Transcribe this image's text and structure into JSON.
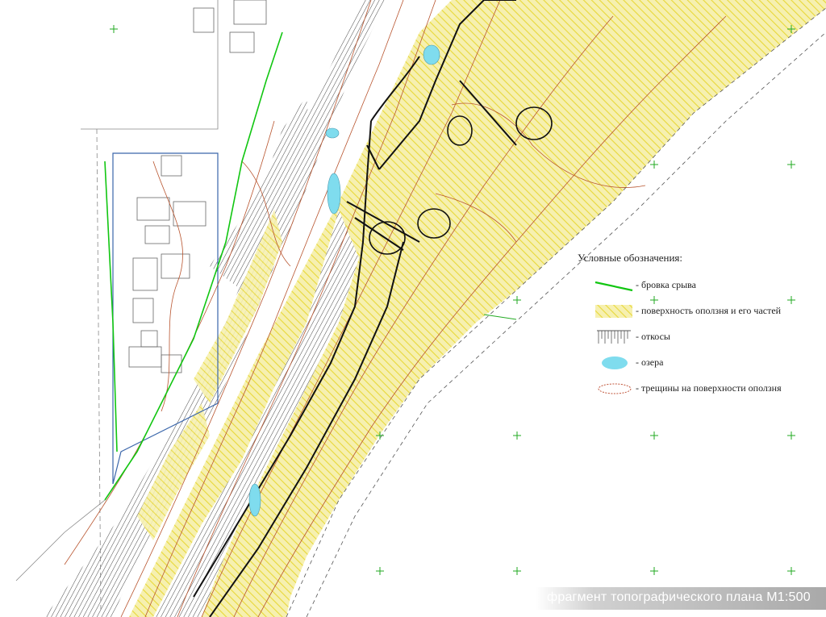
{
  "legend": {
    "title": "Условные обозначения:",
    "items": [
      {
        "id": "scarp",
        "label": "- бровка срыва",
        "color": "#11c611"
      },
      {
        "id": "surface",
        "label": "- поверхность оползня и его частей",
        "color": "#e8d83a"
      },
      {
        "id": "slopes",
        "label": "- откосы",
        "color": "#555555"
      },
      {
        "id": "lakes",
        "label": "- озера",
        "color": "#7fdcee"
      },
      {
        "id": "cracks",
        "label": "- трещины на поверхности оползня",
        "color": "#c0553a"
      }
    ]
  },
  "caption": "фрагмент топографического плана М1:500",
  "colors": {
    "landslide_fill": "#f6f0b0",
    "hatch": "#e8d83a",
    "grid_cross": "#22aa22",
    "contour": "#b8542e",
    "bold_line": "#111111",
    "lake": "#7fdcee"
  }
}
